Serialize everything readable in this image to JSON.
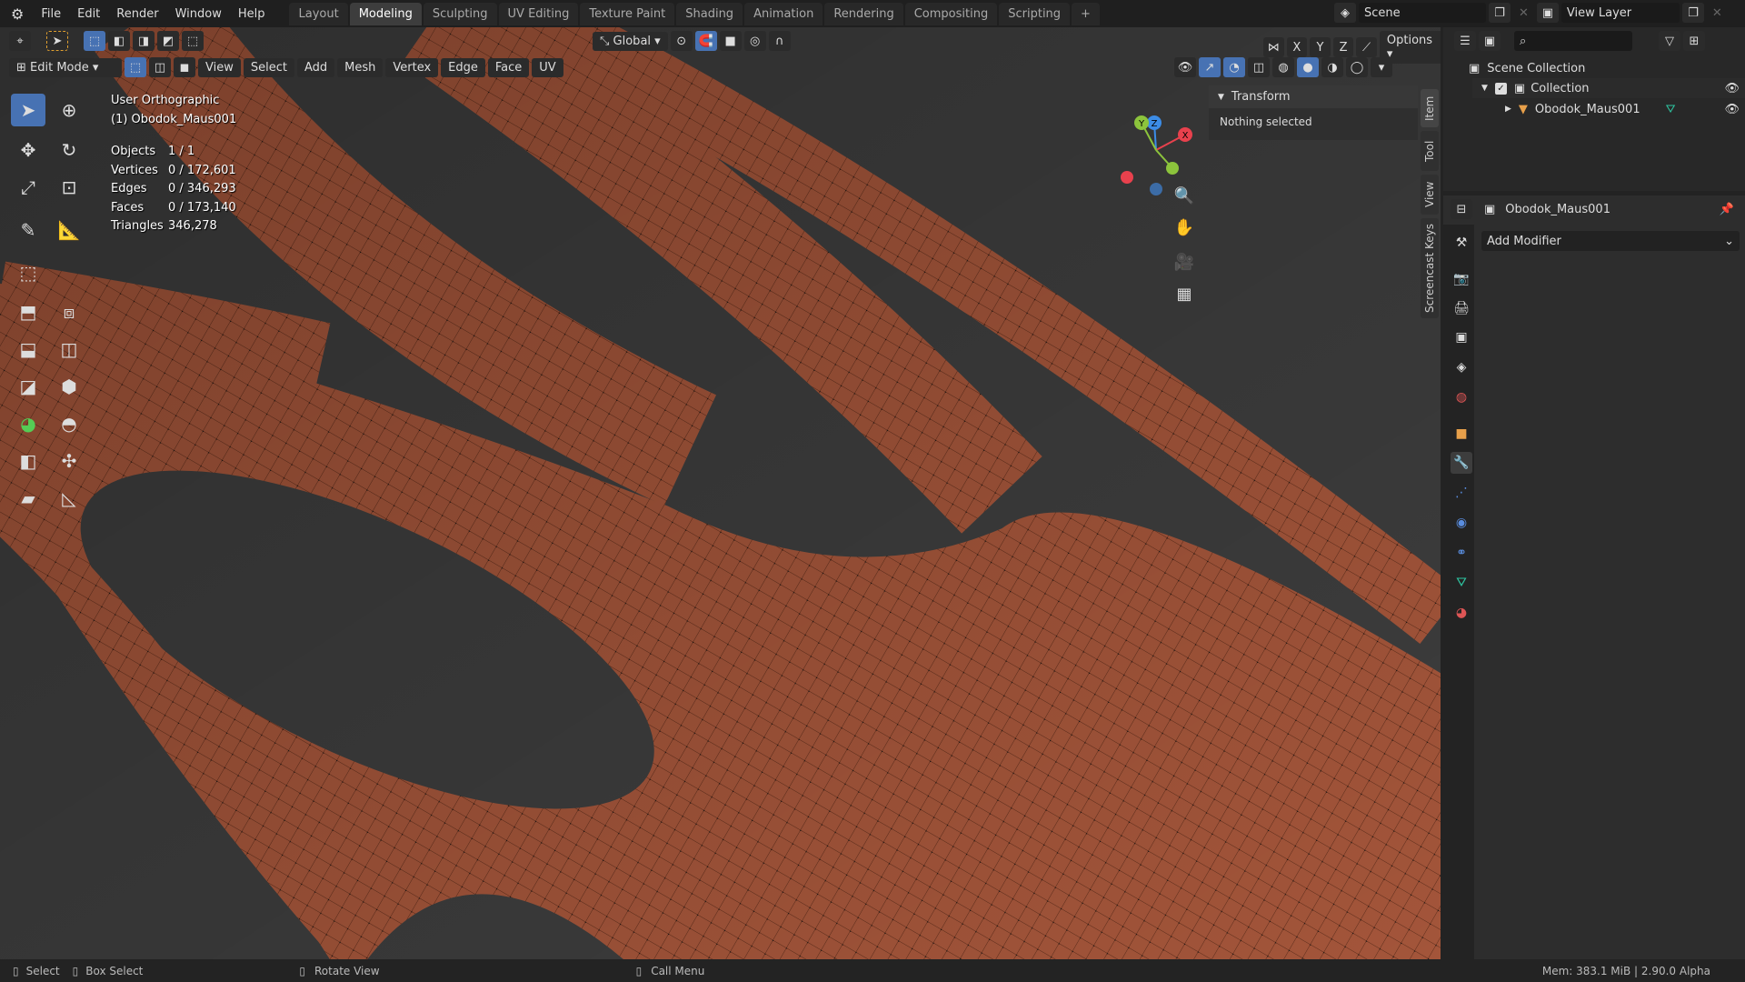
{
  "menu": [
    "File",
    "Edit",
    "Render",
    "Window",
    "Help"
  ],
  "workspaces": [
    "Layout",
    "Modeling",
    "Sculpting",
    "UV Editing",
    "Texture Paint",
    "Shading",
    "Animation",
    "Rendering",
    "Compositing",
    "Scripting"
  ],
  "active_workspace": "Modeling",
  "add_workspace": "+",
  "scene": "Scene",
  "view_layer": "View Layer",
  "tool_header": {
    "orientation": "Global",
    "options": "Options",
    "axes": [
      "X",
      "Y",
      "Z"
    ]
  },
  "view_header": {
    "mode": "Edit Mode",
    "menus": [
      "View",
      "Select",
      "Add",
      "Mesh",
      "Vertex",
      "Edge",
      "Face",
      "UV"
    ]
  },
  "overlay": {
    "view_name": "User Orthographic",
    "object_name": "(1) Obodok_Maus001",
    "stats": [
      {
        "label": "Objects",
        "value": "1 / 1"
      },
      {
        "label": "Vertices",
        "value": "0 / 172,601"
      },
      {
        "label": "Edges",
        "value": "0 / 346,293"
      },
      {
        "label": "Faces",
        "value": "0 / 173,140"
      },
      {
        "label": "Triangles",
        "value": "346,278"
      }
    ]
  },
  "gizmo": {
    "x": "X",
    "y": "Y",
    "z": "Z"
  },
  "sidebar": {
    "panel": "Transform",
    "content": "Nothing selected",
    "tabs": [
      "Item",
      "Tool",
      "View",
      "Screencast Keys"
    ]
  },
  "outliner": {
    "root": "Scene Collection",
    "collection": "Collection",
    "object": "Obodok_Maus001"
  },
  "properties": {
    "object": "Obodok_Maus001",
    "add_modifier": "Add Modifier"
  },
  "status": {
    "select": "Select",
    "box_select": "Box Select",
    "rotate": "Rotate View",
    "call_menu": "Call Menu",
    "info": "Mem: 383.1 MiB | 2.90.0 Alpha"
  },
  "colors": {
    "accent": "#4772b3",
    "mesh": "#a3553a",
    "axis_x": "#e8414d",
    "axis_y": "#8cc43c",
    "axis_z": "#3c8ce6"
  }
}
